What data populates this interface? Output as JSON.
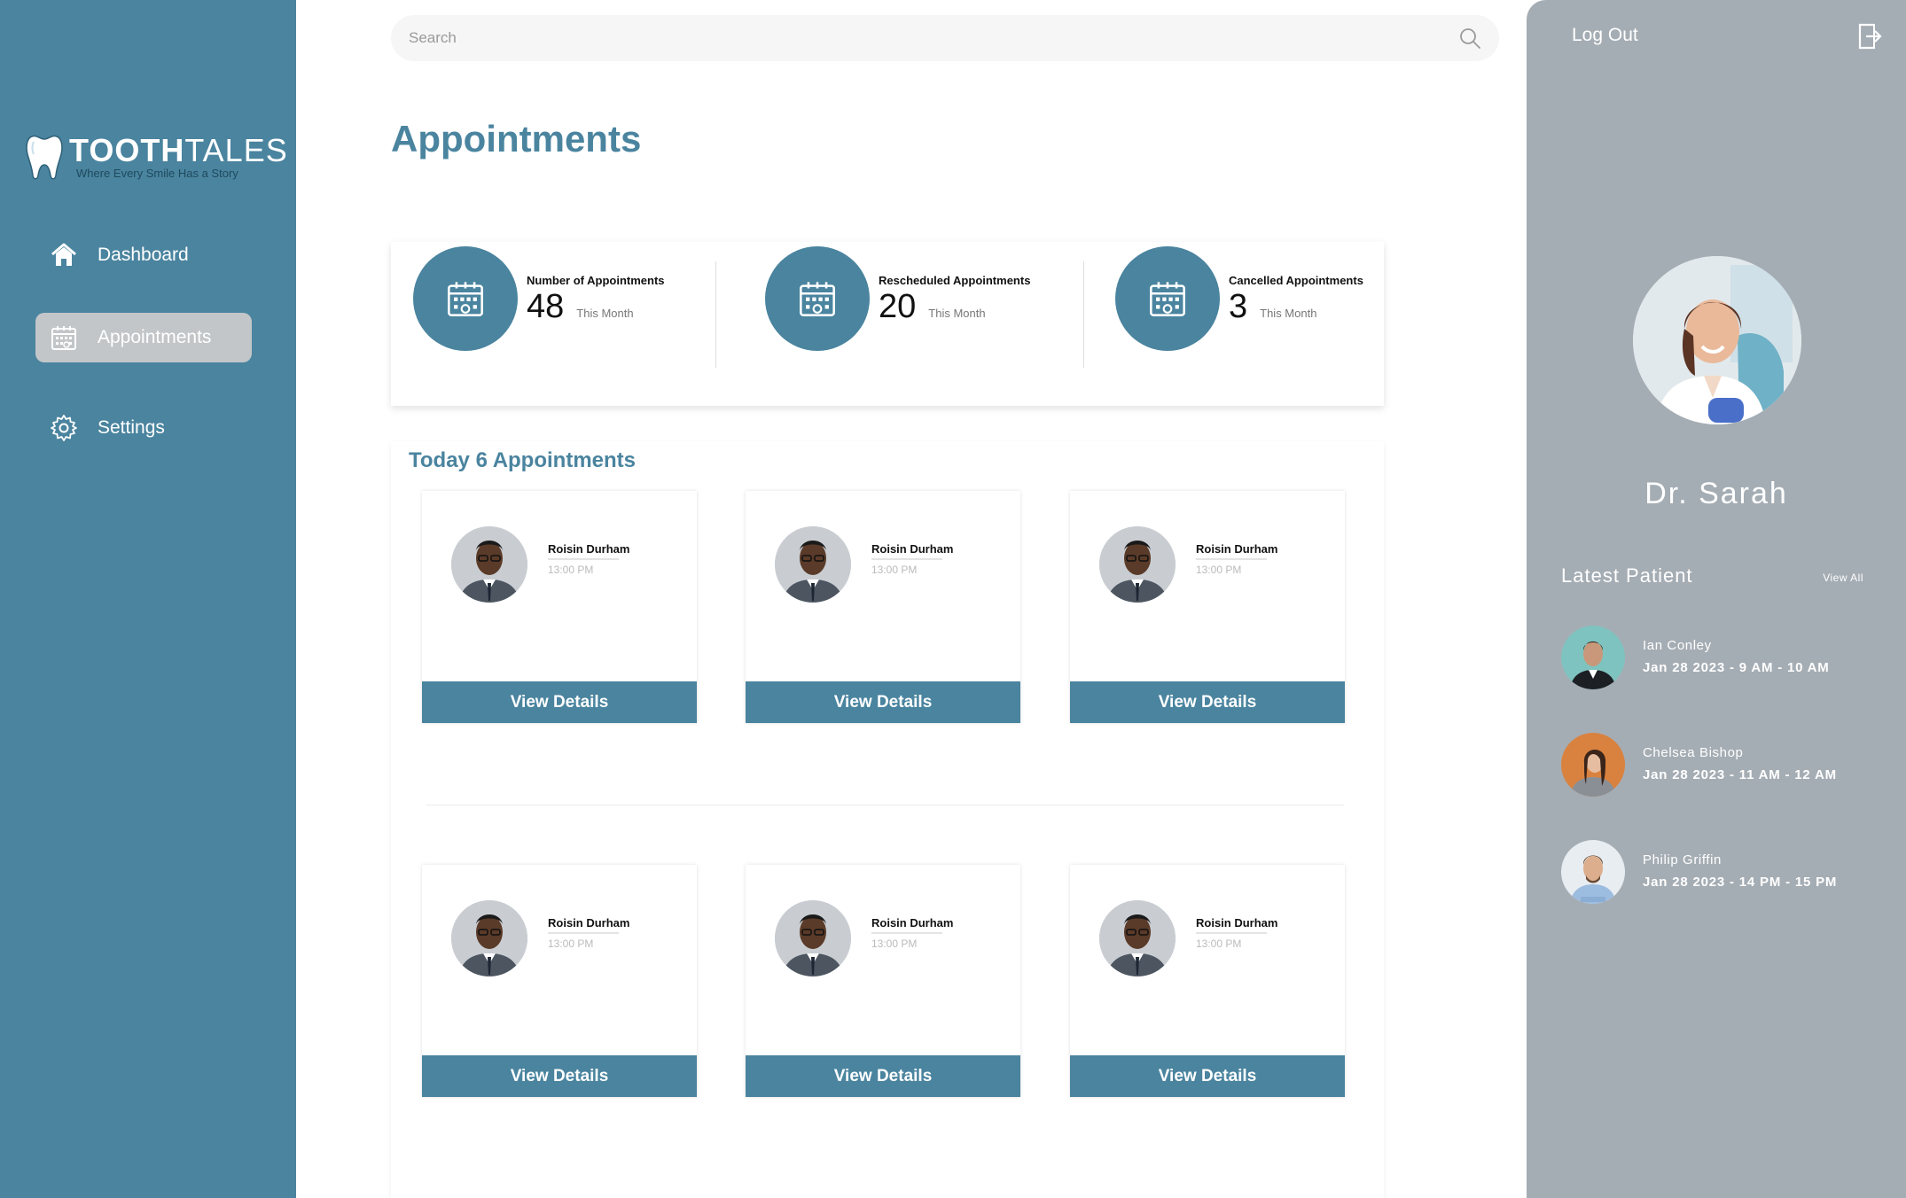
{
  "brand": {
    "name_bold": "TOOTH",
    "name_light": "TALES",
    "tagline": "Where Every Smile Has a Story"
  },
  "sidebar": {
    "items": [
      {
        "label": "Dashboard",
        "icon": "home-icon",
        "active": false
      },
      {
        "label": "Appointments",
        "icon": "calendar-icon",
        "active": true
      },
      {
        "label": "Settings",
        "icon": "gear-icon",
        "active": false
      }
    ]
  },
  "search": {
    "placeholder": "Search"
  },
  "page": {
    "title": "Appointments"
  },
  "stats": [
    {
      "label": "Number of Appointments",
      "value": "48",
      "sub": "This Month"
    },
    {
      "label": "Rescheduled  Appointments",
      "value": "20",
      "sub": "This Month"
    },
    {
      "label": "Cancelled Appointments",
      "value": "3",
      "sub": "This Month"
    }
  ],
  "today": {
    "title": "Today 6 Appointments",
    "cards": [
      {
        "name": "Roisin Durham",
        "time": "13:00 PM",
        "button": "View Details"
      },
      {
        "name": "Roisin Durham",
        "time": "13:00 PM",
        "button": "View Details"
      },
      {
        "name": "Roisin Durham",
        "time": "13:00 PM",
        "button": "View Details"
      },
      {
        "name": "Roisin Durham",
        "time": "13:00 PM",
        "button": "View Details"
      },
      {
        "name": "Roisin Durham",
        "time": "13:00 PM",
        "button": "View Details"
      },
      {
        "name": "Roisin Durham",
        "time": "13:00 PM",
        "button": "View Details"
      }
    ]
  },
  "profile": {
    "logout_label": "Log Out",
    "doctor_name": "Dr. Sarah",
    "latest_title": "Latest Patient",
    "view_all": "View All",
    "patients": [
      {
        "name": "Ian Conley",
        "time": "Jan 28 2023 - 9 AM - 10 AM"
      },
      {
        "name": "Chelsea Bishop",
        "time": "Jan 28 2023 - 11 AM - 12 AM"
      },
      {
        "name": "Philip Griffin",
        "time": "Jan 28 2023 - 14 PM - 15 PM"
      }
    ]
  },
  "colors": {
    "accent": "#4a849f",
    "right_panel": "#a5adb4",
    "active_nav": "#c3c6c9"
  }
}
